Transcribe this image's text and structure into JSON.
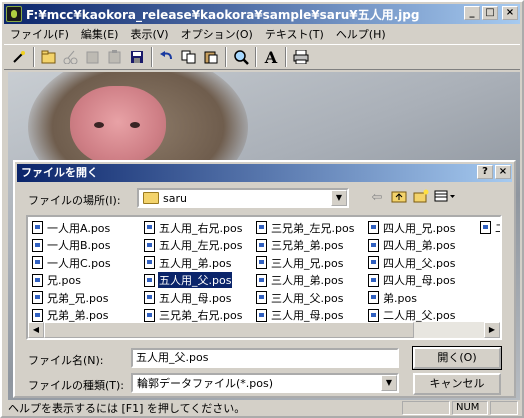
{
  "window": {
    "title": "F:¥mcc¥kaokora_release¥kaokora¥sample¥saru¥五人用.jpg"
  },
  "window_buttons": {
    "minimize": "_",
    "maximize": "□",
    "close": "×"
  },
  "menu": [
    "ファイル(F)",
    "編集(E)",
    "表示(V)",
    "オプション(O)",
    "テキスト(T)",
    "ヘルプ(H)"
  ],
  "toolbar": {
    "icons": [
      "wand-icon",
      "open-icon",
      "cut-disabled-icon",
      "copy-disabled-icon",
      "paste-disabled-icon",
      "save-icon",
      "undo-icon",
      "copy-icon",
      "paste-icon",
      "search-icon",
      "text-icon",
      "print-icon"
    ],
    "text_tool_label": "A"
  },
  "dialog": {
    "title": "ファイルを開く",
    "help_button": "?",
    "close_button": "×",
    "look_in_label": "ファイルの場所(I):",
    "look_in_value": "saru",
    "file_columns": [
      [
        "一人用A.pos",
        "一人用B.pos",
        "一人用C.pos",
        "兄.pos",
        "兄弟_兄.pos",
        "兄弟_弟.pos"
      ],
      [
        "五人用_右兄.pos",
        "五人用_左兄.pos",
        "五人用_弟.pos",
        "五人用_父.pos",
        "五人用_母.pos",
        "三兄弟_右兄.pos"
      ],
      [
        "三兄弟_左兄.pos",
        "三兄弟_弟.pos",
        "三人用_兄.pos",
        "三人用_弟.pos",
        "三人用_父.pos",
        "三人用_母.pos"
      ],
      [
        "四人用_兄.pos",
        "四人用_弟.pos",
        "四人用_父.pos",
        "四人用_母.pos",
        "弟.pos",
        "二人用_父.pos"
      ],
      [
        "二"
      ]
    ],
    "selected_file": "五人用_父.pos",
    "filename_label": "ファイル名(N):",
    "filename_value": "五人用_父.pos",
    "filetype_label": "ファイルの種類(T):",
    "filetype_value": "輪郭データファイル(*.pos)",
    "open_button": "開く(O)",
    "cancel_button": "キャンセル"
  },
  "status": {
    "text": "ヘルプを表示するには [F1] を押してください。",
    "num": "NUM"
  }
}
